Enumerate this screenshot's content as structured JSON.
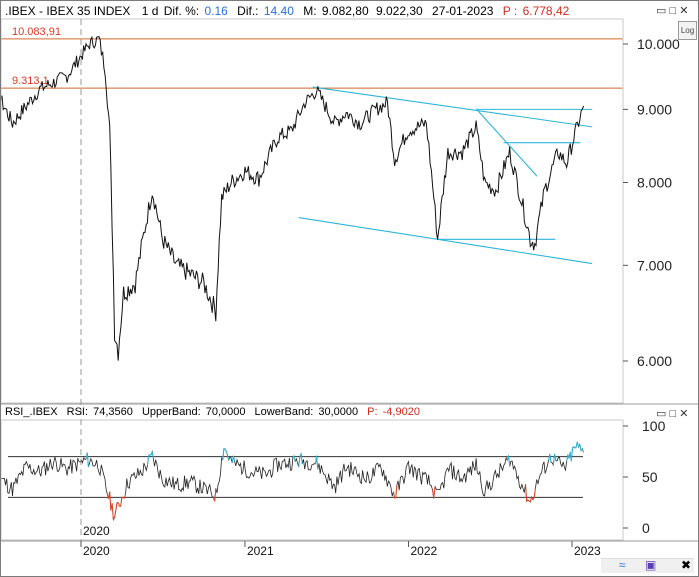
{
  "header": {
    "symbol": ".IBEX - IBEX 35 INDEX",
    "period": "1 d",
    "dif_pct_label": "Dif. %:",
    "dif_pct_value": "0.16",
    "dif_label": "Dif.:",
    "dif_value": "14.40",
    "m_label": "M:",
    "m_value": "9.082,80",
    "m2_value": "9.022,30",
    "date": "27-01-2023",
    "p_label": "P :",
    "p_value": "6.778,42",
    "log_button": "Log"
  },
  "rsi_header": {
    "name": "RSI_.IBEX",
    "rsi_label": "RSI:",
    "rsi_value": "74,3560",
    "upper_label": "UpperBand:",
    "upper_value": "70,0000",
    "lower_label": "LowerBand:",
    "lower_value": "30,0000",
    "p_label": "P:",
    "p_value": "-4,9020"
  },
  "chart_data": [
    {
      "type": "line",
      "title": ".IBEX - IBEX 35 INDEX",
      "x_range": [
        "2019-05",
        "2023-02"
      ],
      "ylim": [
        5700,
        10400
      ],
      "y_ticks": [
        "10.000",
        "9.000",
        "8.000",
        "7.000",
        "6.000"
      ],
      "x_ticks": [
        "2020",
        "2021",
        "2022",
        "2023"
      ],
      "series": [
        {
          "values": [
            [
              "2019-05-01",
              9250
            ],
            [
              "2019-06-01",
              8700
            ],
            [
              "2019-07-01",
              9200
            ],
            [
              "2019-08-01",
              8800
            ],
            [
              "2019-09-01",
              9050
            ],
            [
              "2019-10-01",
              9300
            ],
            [
              "2019-11-01",
              9400
            ],
            [
              "2019-12-01",
              9500
            ],
            [
              "2020-01-20",
              10000
            ],
            [
              "2020-02-10",
              10083
            ],
            [
              "2020-02-24",
              9600
            ],
            [
              "2020-03-05",
              8700
            ],
            [
              "2020-03-16",
              6300
            ],
            [
              "2020-03-24",
              6100
            ],
            [
              "2020-04-05",
              6700
            ],
            [
              "2020-05-01",
              6800
            ],
            [
              "2020-06-08",
              7900
            ],
            [
              "2020-07-01",
              7300
            ],
            [
              "2020-08-01",
              7000
            ],
            [
              "2020-09-01",
              6900
            ],
            [
              "2020-10-01",
              6800
            ],
            [
              "2020-10-28",
              6500
            ],
            [
              "2020-11-10",
              7800
            ],
            [
              "2020-12-01",
              8000
            ],
            [
              "2021-01-01",
              8150
            ],
            [
              "2021-02-01",
              8050
            ],
            [
              "2021-03-15",
              8600
            ],
            [
              "2021-04-15",
              8700
            ],
            [
              "2021-05-15",
              9100
            ],
            [
              "2021-06-10",
              9280
            ],
            [
              "2021-07-20",
              8800
            ],
            [
              "2021-08-15",
              8950
            ],
            [
              "2021-09-15",
              8800
            ],
            [
              "2021-10-20",
              9000
            ],
            [
              "2021-11-15",
              9100
            ],
            [
              "2021-12-01",
              8300
            ],
            [
              "2021-12-31",
              8700
            ],
            [
              "2022-02-10",
              8800
            ],
            [
              "2022-03-07",
              7300
            ],
            [
              "2022-03-30",
              8400
            ],
            [
              "2022-05-01",
              8400
            ],
            [
              "2022-06-01",
              8750
            ],
            [
              "2022-06-20",
              8000
            ],
            [
              "2022-07-15",
              7900
            ],
            [
              "2022-08-15",
              8400
            ],
            [
              "2022-09-30",
              7300
            ],
            [
              "2022-10-10",
              7250
            ],
            [
              "2022-11-01",
              7900
            ],
            [
              "2022-12-01",
              8400
            ],
            [
              "2022-12-20",
              8250
            ],
            [
              "2023-01-10",
              8700
            ],
            [
              "2023-01-27",
              9050
            ]
          ]
        }
      ],
      "horizontal_lines": [
        {
          "value": 10083.91,
          "label": "10.083,91",
          "color": "#d2692a"
        },
        {
          "value": 9313.1,
          "label": "9.313,1",
          "color": "#d2692a"
        }
      ],
      "trendlines": [
        {
          "from": [
            "2021-06-01",
            9330
          ],
          "to": [
            "2023-02-15",
            8750
          ],
          "color": "#2bb5d9"
        },
        {
          "from": [
            "2021-05-01",
            7560
          ],
          "to": [
            "2023-02-15",
            7020
          ],
          "color": "#2bb5d9"
        },
        {
          "from": [
            "2022-03-07",
            7300
          ],
          "to": [
            "2022-11-25",
            7300
          ],
          "color": "#2bb5d9"
        },
        {
          "from": [
            "2022-06-01",
            9000
          ],
          "to": [
            "2023-02-15",
            9000
          ],
          "color": "#2bb5d9"
        },
        {
          "from": [
            "2022-08-01",
            8530
          ],
          "to": [
            "2023-01-20",
            8530
          ],
          "color": "#2bb5d9"
        },
        {
          "from": [
            "2022-06-05",
            8980
          ],
          "to": [
            "2022-10-15",
            8080
          ],
          "color": "#2bb5d9"
        }
      ]
    },
    {
      "type": "line",
      "title": "RSI_.IBEX",
      "ylim": [
        0,
        100
      ],
      "y_ticks": [
        "100",
        "50",
        "0"
      ],
      "bands": {
        "upper": 70,
        "lower": 30
      },
      "series": [
        {
          "values": [
            [
              "2019-05-01",
              35
            ],
            [
              "2019-06-01",
              62
            ],
            [
              "2019-07-01",
              50
            ],
            [
              "2019-08-01",
              38
            ],
            [
              "2019-09-01",
              60
            ],
            [
              "2019-10-01",
              55
            ],
            [
              "2019-11-01",
              65
            ],
            [
              "2019-12-01",
              58
            ],
            [
              "2020-01-15",
              67
            ],
            [
              "2020-02-10",
              62
            ],
            [
              "2020-03-05",
              28
            ],
            [
              "2020-03-16",
              12
            ],
            [
              "2020-04-15",
              45
            ],
            [
              "2020-05-15",
              55
            ],
            [
              "2020-06-08",
              70
            ],
            [
              "2020-07-01",
              48
            ],
            [
              "2020-08-01",
              42
            ],
            [
              "2020-09-01",
              45
            ],
            [
              "2020-10-28",
              32
            ],
            [
              "2020-11-15",
              80
            ],
            [
              "2020-12-01",
              65
            ],
            [
              "2021-01-15",
              55
            ],
            [
              "2021-02-15",
              52
            ],
            [
              "2021-03-15",
              62
            ],
            [
              "2021-05-01",
              66
            ],
            [
              "2021-06-10",
              64
            ],
            [
              "2021-07-20",
              40
            ],
            [
              "2021-08-15",
              60
            ],
            [
              "2021-10-01",
              48
            ],
            [
              "2021-11-01",
              60
            ],
            [
              "2021-12-01",
              32
            ],
            [
              "2022-01-01",
              60
            ],
            [
              "2022-02-15",
              45
            ],
            [
              "2022-03-07",
              30
            ],
            [
              "2022-04-01",
              58
            ],
            [
              "2022-05-01",
              48
            ],
            [
              "2022-06-01",
              62
            ],
            [
              "2022-06-20",
              36
            ],
            [
              "2022-08-15",
              68
            ],
            [
              "2022-09-30",
              25
            ],
            [
              "2022-10-20",
              50
            ],
            [
              "2022-11-15",
              70
            ],
            [
              "2022-12-15",
              58
            ],
            [
              "2023-01-10",
              80
            ],
            [
              "2023-01-27",
              74
            ]
          ]
        }
      ]
    }
  ]
}
